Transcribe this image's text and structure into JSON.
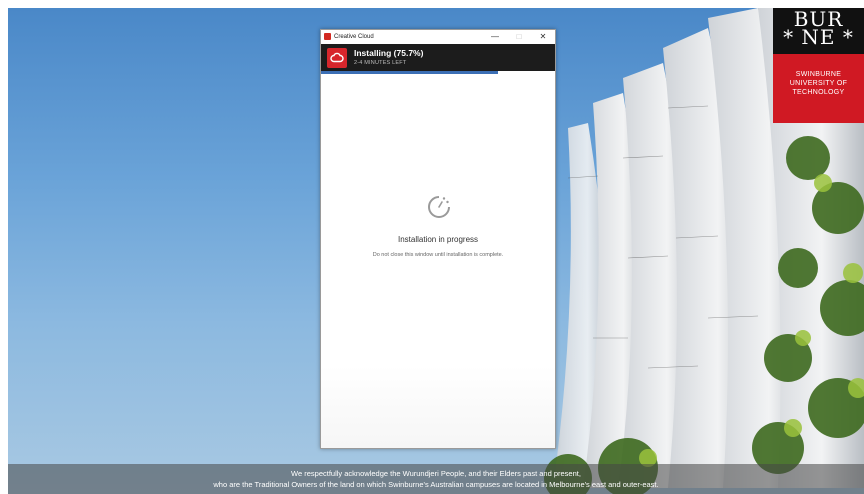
{
  "window": {
    "title": "Creative Cloud",
    "minimize_glyph": "—",
    "maximize_glyph": "□",
    "close_glyph": "✕"
  },
  "install": {
    "status": "Installing (75.7%)",
    "progress_percent": 75.7,
    "time_left": "2-4 MINUTES LEFT",
    "heading": "Installation in progress",
    "note": "Do not close this window until installation is complete."
  },
  "wallpaper": {
    "logo_top": "BUR",
    "logo_mid": "* NE *",
    "logo_line1": "SWINBURNE",
    "logo_line2": "UNIVERSITY OF",
    "logo_line3": "TECHNOLOGY",
    "ack_line1": "We respectfully acknowledge the Wurundjeri People, and their Elders past and present,",
    "ack_line2": "who are the Traditional Owners of the land on which Swinburne's Australian campuses are located in Melbourne's east and outer-east."
  },
  "colors": {
    "adobe_red": "#d7262c",
    "progress_blue": "#3c6fb5",
    "header_dark": "#1c1c1c",
    "swinburne_red": "#d01923"
  },
  "icons": {
    "app": "creative-cloud-icon",
    "spinner": "loading-clock-icon"
  }
}
